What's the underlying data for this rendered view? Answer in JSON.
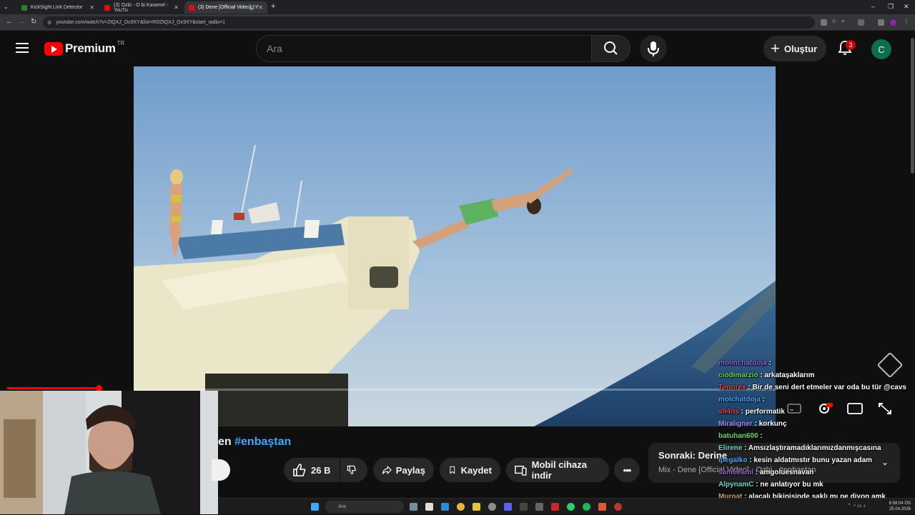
{
  "browser": {
    "tabs": [
      {
        "title": "KickSight Link Detector",
        "favicon_color": "#2e7d32"
      },
      {
        "title": "(3) Ozbi - O bi Karamel - YouTu",
        "favicon_color": "#ff0000"
      },
      {
        "title": "(3) Dene [Official Video] - Y",
        "favicon_color": "#ff0000"
      }
    ],
    "url": "youtube.com/watch?v=ZtQXJ_Oc9XY&list=RDZtQXJ_Oc9XY&start_radio=1"
  },
  "header": {
    "brand": "Premium",
    "country_code": "TR",
    "search_placeholder": "Ara",
    "create_label": "Oluştur",
    "notification_count": "3",
    "avatar_letter": "C"
  },
  "video": {
    "progress_fraction": 0.0,
    "title_fragment": "en ",
    "title_hashtag": "#enbaştan"
  },
  "actions": {
    "like_count": "26 B",
    "share_label": "Paylaş",
    "save_label": "Kaydet",
    "download_label": "Mobil cihaza indir",
    "more_label": "•••"
  },
  "up_next": {
    "label": "Sonraki: Derine",
    "subtitle": "Mix - Dene [Official Video] - Ozbi · #enbaştan"
  },
  "chat": [
    {
      "user": "molmchatdoja",
      "color": "#8f5fd6",
      "msg": ""
    },
    {
      "user": "ciodimarzio",
      "color": "#5fd65f",
      "msg": "arkataşaklarım"
    },
    {
      "user": "Tonnrex",
      "color": "#d64a4a",
      "msg": "Bir de seni dert etmeler var oda bu tür @cavs"
    },
    {
      "user": "molchatdoja",
      "color": "#3ea6ff",
      "msg": ""
    },
    {
      "user": "sh4ns",
      "color": "#d64a4a",
      "msg": "performatik"
    },
    {
      "user": "Miraligner",
      "color": "#a78bfa",
      "msg": "korkunç"
    },
    {
      "user": "batuhan600",
      "color": "#5fd65f",
      "msg": ""
    },
    {
      "user": "Elirene",
      "color": "#5fd6c6",
      "msg": "Amsızlaştıramadıklarımızdanmışcasına"
    },
    {
      "user": "ipegalko",
      "color": "#3ea6ff",
      "msg": "kesin aldatmıstır bunu yazan adam"
    },
    {
      "user": "samueaml",
      "color": "#8f5fd6",
      "msg": "amgoluesnavan"
    },
    {
      "user": "AlpynamC",
      "color": "#5fd6c6",
      "msg": "ne anlatıyor bu mk"
    },
    {
      "user": "Muroat",
      "color": "#d69a5f",
      "msg": "alacalı bikinisinde saklı mı ne diyon amk"
    },
    {
      "user": "son",
      "color": "#d6d65f",
      "msg": "Ne güzel şarkı niye amk"
    }
  ],
  "taskbar": {
    "search_label": "Ara",
    "time": "6:58:04 ÖS",
    "date": "25.04.2026"
  }
}
